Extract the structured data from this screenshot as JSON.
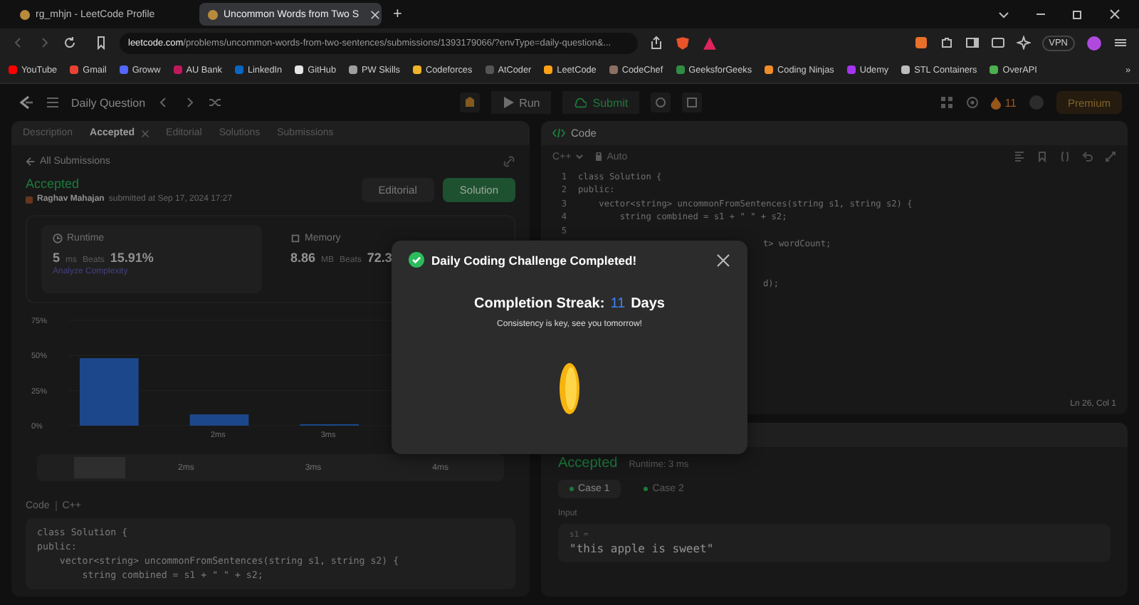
{
  "browser": {
    "tabs": [
      {
        "title": "rg_mhjn - LeetCode Profile",
        "selected": false
      },
      {
        "title": "Uncommon Words from Two S",
        "selected": true
      }
    ],
    "new_tab": "+",
    "url_host": "leetcode.com",
    "url_path": "/problems/uncommon-words-from-two-sentences/submissions/1393179066/?envType=daily-question&...",
    "vpn": "VPN",
    "bookmarks": [
      {
        "label": "YouTube",
        "color": "#ff0000"
      },
      {
        "label": "Gmail",
        "color": "#ea4335"
      },
      {
        "label": "Groww",
        "color": "#5367ff"
      },
      {
        "label": "AU Bank",
        "color": "#c2185b"
      },
      {
        "label": "LinkedIn",
        "color": "#0a66c2"
      },
      {
        "label": "GitHub",
        "color": "#e6e6e6"
      },
      {
        "label": "PW Skills",
        "color": "#9e9e9e"
      },
      {
        "label": "Codeforces",
        "color": "#f0b429"
      },
      {
        "label": "AtCoder",
        "color": "#555555"
      },
      {
        "label": "LeetCode",
        "color": "#ffa116"
      },
      {
        "label": "CodeChef",
        "color": "#8d6e63"
      },
      {
        "label": "GeeksforGeeks",
        "color": "#2f8d46"
      },
      {
        "label": "Coding Ninjas",
        "color": "#f28c28"
      },
      {
        "label": "Udemy",
        "color": "#a435f0"
      },
      {
        "label": "STL Containers",
        "color": "#bdbdbd"
      },
      {
        "label": "OverAPI",
        "color": "#4caf50"
      }
    ],
    "more": "»"
  },
  "toolbar": {
    "title": "Daily Question",
    "run": "Run",
    "submit": "Submit",
    "streak": "11",
    "premium": "Premium"
  },
  "left_panel": {
    "tabs": [
      {
        "label": "Description",
        "selected": false,
        "closable": false
      },
      {
        "label": "Accepted",
        "selected": true,
        "closable": true
      },
      {
        "label": "Editorial",
        "selected": false,
        "closable": false
      },
      {
        "label": "Solutions",
        "selected": false,
        "closable": false
      },
      {
        "label": "Submissions",
        "selected": false,
        "closable": false
      }
    ],
    "back": "All Submissions",
    "status": "Accepted",
    "author": "Raghav Mahajan",
    "submitted": "submitted at Sep 17, 2024 17:27",
    "buttons": [
      {
        "label": "Editorial",
        "kind": "secondary"
      },
      {
        "label": "Solution",
        "kind": "primary"
      }
    ],
    "runtime": {
      "label": "Runtime",
      "value": "5",
      "unit": "ms",
      "beats_label": "Beats",
      "beats": "15.91%",
      "link": "Analyze Complexity"
    },
    "memory": {
      "label": "Memory",
      "value": "8.86",
      "unit": "MB",
      "beats_label": "Beats",
      "beats": "72.3"
    },
    "chart_data": {
      "type": "bar",
      "categories": [
        null,
        "2ms",
        "3ms"
      ],
      "values": [
        48,
        8,
        1
      ],
      "ylim": [
        0,
        75
      ],
      "yticks": [
        {
          "value": 0,
          "label": "0%"
        },
        {
          "value": 25,
          "label": "25%"
        },
        {
          "value": 50,
          "label": "50%"
        },
        {
          "value": 75,
          "label": "75%"
        }
      ]
    },
    "range_handle": {
      "level": 0.08
    },
    "range_labels": [
      "2ms",
      "3ms",
      "4ms"
    ],
    "code_label": "Code",
    "code_lang": "C++",
    "code": [
      "class Solution {",
      "public:",
      "    vector<string> uncommonFromSentences(string s1, string s2) {",
      "        string combined = s1 + \" \" + s2;"
    ]
  },
  "editor": {
    "title": "Code",
    "language": "C++",
    "mode": "Auto",
    "cursor": "Ln 26, Col 1",
    "lines": [
      {
        "kind": "full",
        "number": "1",
        "text": "class Solution {"
      },
      {
        "kind": "full",
        "number": "2",
        "text": "public:"
      },
      {
        "kind": "full",
        "number": "3",
        "text": "    vector<string> uncommonFromSentences(string s1, string s2) {"
      },
      {
        "kind": "full",
        "number": "4",
        "text": "        string combined = s1 + \" \" + s2;"
      },
      {
        "kind": "full",
        "number": "5"
      },
      {
        "kind": "fragment",
        "text": "t> wordCount;"
      },
      {
        "kind": "hidden"
      },
      {
        "kind": "hidden"
      },
      {
        "kind": "fragment",
        "text": "d);"
      }
    ]
  },
  "result": {
    "status": "Accepted",
    "runtime": "Runtime: 3 ms",
    "cases": [
      {
        "label": "Case 1",
        "selected": true
      },
      {
        "label": "Case 2",
        "selected": false
      }
    ],
    "input_label": "Input",
    "variable": "s1 =",
    "value": "\"this apple is sweet\""
  },
  "modal": {
    "title": "Daily Coding Challenge Completed!",
    "streak_label": "Completion Streak:",
    "streak": "11",
    "streak_unit": "Days",
    "message": "Consistency is key, see you tomorrow!"
  }
}
